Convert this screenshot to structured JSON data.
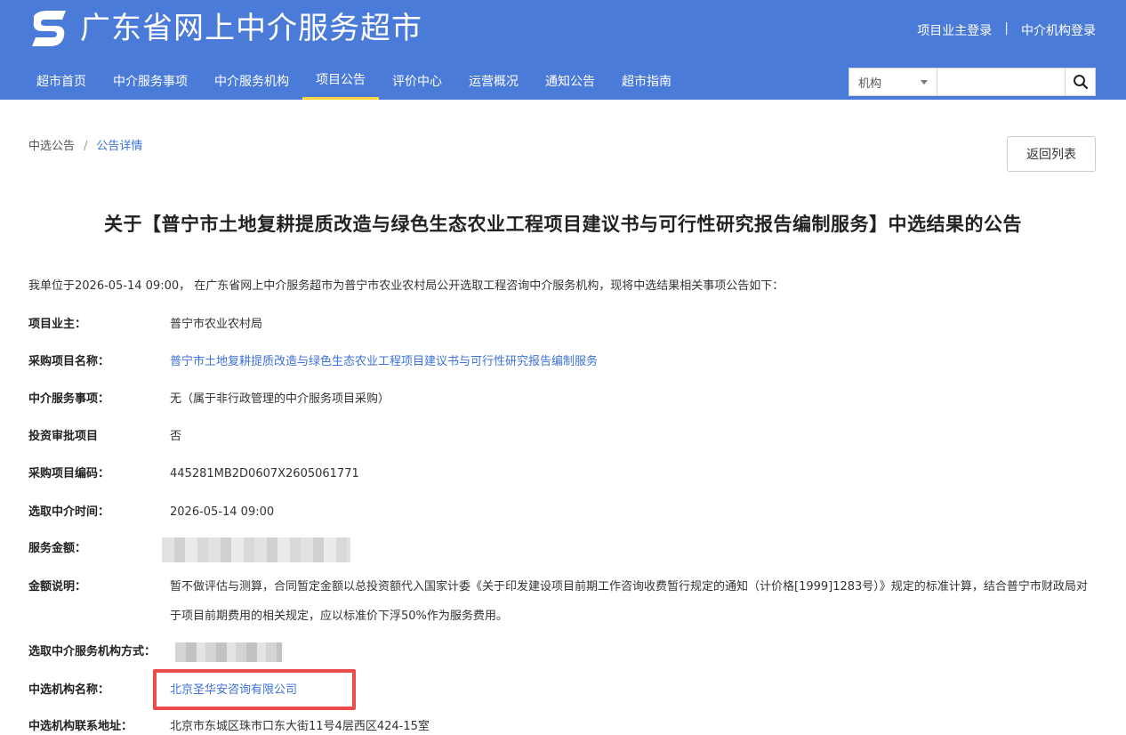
{
  "header": {
    "site_title": "广东省网上中介服务超市",
    "login_owner": "项目业主登录",
    "login_separator": "|",
    "login_agency": "中介机构登录"
  },
  "nav": {
    "items": [
      "超市首页",
      "中介服务事项",
      "中介服务机构",
      "项目公告",
      "评价中心",
      "运营概况",
      "通知公告",
      "超市指南"
    ],
    "active": "项目公告"
  },
  "search": {
    "select_value": "机构",
    "input_value": ""
  },
  "breadcrumb": {
    "parent": "中选公告",
    "separator": "/",
    "current": "公告详情"
  },
  "back_button": "返回列表",
  "notice": {
    "title": "关于【普宁市土地复耕提质改造与绿色生态农业工程项目建议书与可行性研究报告编制服务】中选结果的公告",
    "intro": "我单位于2026-05-14 09:00， 在广东省网上中介服务超市为普宁市农业农村局公开选取工程咨询中介服务机构，现将中选结果相关事项公告如下：",
    "fields": {
      "owner": {
        "label": "项目业主：",
        "value": "普宁市农业农村局"
      },
      "project_name": {
        "label": "采购项目名称：",
        "value": "普宁市土地复耕提质改造与绿色生态农业工程项目建议书与可行性研究报告编制服务"
      },
      "service_item": {
        "label": "中介服务事项：",
        "value": "无（属于非行政管理的中介服务项目采购）"
      },
      "investment_approval": {
        "label": "投资审批项目",
        "value": "否"
      },
      "project_code": {
        "label": "采购项目编码：",
        "value": "445281MB2D0607X2605061771"
      },
      "selection_time": {
        "label": "选取中介时间：",
        "value": "2026-05-14 09:00"
      },
      "amount": {
        "label": "服务金额：",
        "value": ""
      },
      "amount_note": {
        "label": "金额说明：",
        "value": "暂不做评估与测算，合同暂定金额以总投资额代入国家计委《关于印发建设项目前期工作咨询收费暂行规定的通知（计价格[1999]1283号）》规定的标准计算，结合普宁市财政局对于项目前期费用的相关规定，应以标准价下浮50%作为服务费用。"
      },
      "selection_method": {
        "label": "选取中介服务机构方式：",
        "value": ""
      },
      "winner_name": {
        "label": "中选机构名称：",
        "value": "北京圣华安咨询有限公司"
      },
      "winner_address": {
        "label": "中选机构联系地址：",
        "value": "北京市东城区珠市口东大街11号4层西区424-15室"
      }
    }
  },
  "colors": {
    "brand_blue": "#4b7bd9",
    "nav_active_underline": "#ffd23f",
    "link_blue": "#3d72d8",
    "highlight_red": "#ea4b4b"
  }
}
